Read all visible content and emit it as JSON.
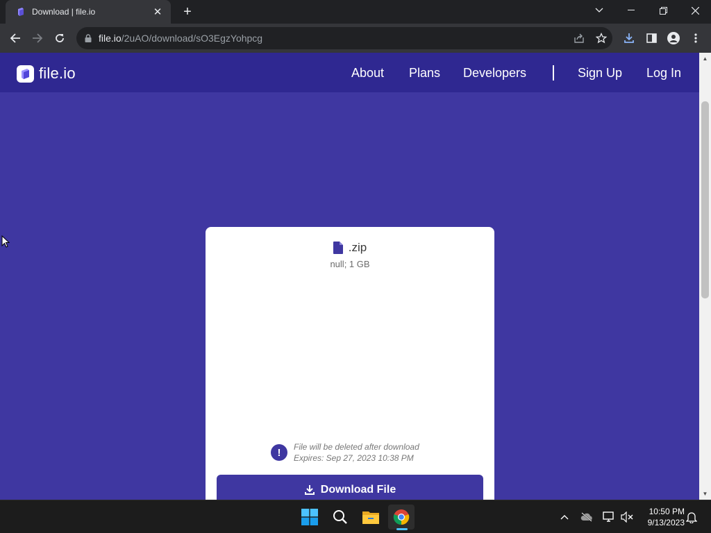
{
  "browser": {
    "tab": {
      "title": "Download | file.io"
    },
    "address": {
      "host": "file.io",
      "path": "/2uAO/download/sO3EgzYohpcg"
    }
  },
  "site": {
    "logo_text": "file.io",
    "nav": {
      "about": "About",
      "plans": "Plans",
      "developers": "Developers",
      "separator": "|",
      "sign_up": "Sign Up",
      "log_in": "Log In"
    }
  },
  "file": {
    "name": ".zip",
    "meta": "null; 1 GB",
    "warning_line1": "File will be deleted after download",
    "warning_line2": "Expires: Sep 27, 2023 10:38 PM",
    "download_label": "Download File"
  },
  "taskbar": {
    "time": "10:50 PM",
    "date": "9/13/2023"
  },
  "colors": {
    "brand": "#3f37a1",
    "header": "#2f2891"
  },
  "icons": [
    "file-io-favicon",
    "close-icon",
    "plus-icon",
    "back-icon",
    "forward-icon",
    "reload-icon",
    "lock-icon",
    "share-icon",
    "star-icon",
    "download-icon",
    "sidebar-icon",
    "profile-icon",
    "menu-icon",
    "file-icon",
    "alert-icon",
    "windows-icon",
    "search-icon",
    "folder-icon",
    "chrome-icon",
    "cloud-icon",
    "network-icon",
    "volume-icon",
    "bell-icon"
  ]
}
